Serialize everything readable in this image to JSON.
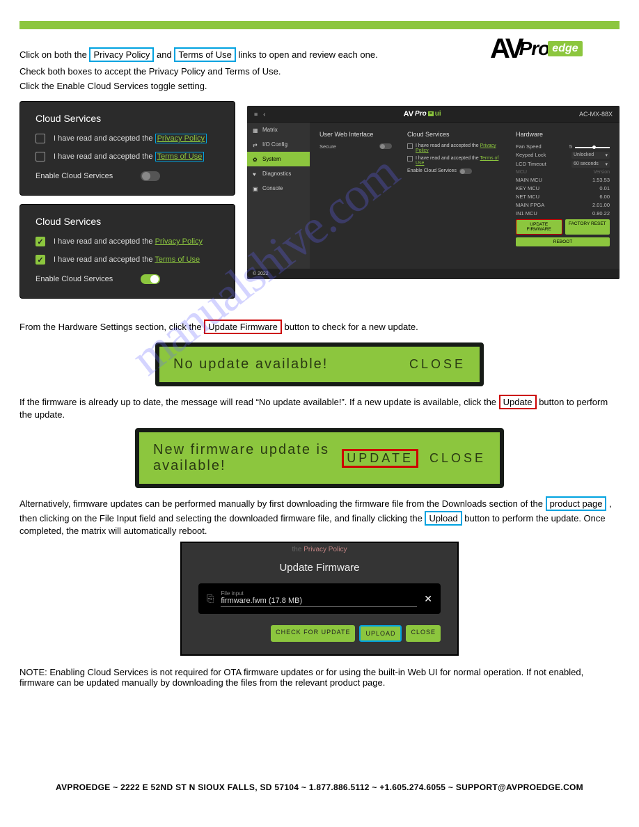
{
  "logo": {
    "a": "AV",
    "pro": "Pro",
    "edge": "edge"
  },
  "step3_pre": "Click on both the ",
  "step3_pp": "Privacy Policy",
  "step3_and": " and ",
  "step3_tu": "Terms of Use",
  "step3_post": " links to open and review each one.",
  "step4": "Check both boxes to accept the Privacy Policy and Terms of Use.",
  "step5": "Click the Enable Cloud Services toggle setting.",
  "cs": {
    "title": "Cloud Services",
    "row_pp_pre": "I have read and accepted the",
    "row_pp_link": "Privacy Policy",
    "row_tu_pre": "I have read and accepted the",
    "row_tu_link": "Terms of Use",
    "enable": "Enable Cloud Services"
  },
  "sys": {
    "model": "AC-MX-88X",
    "nav": [
      "Matrix",
      "I/O Config",
      "System",
      "Diagnostics",
      "Console"
    ],
    "col1_title": "User Web Interface",
    "secure": "Secure",
    "col2_title": "Cloud Services",
    "col3_title": "Hardware",
    "fan": "Fan Speed",
    "fan_val": "5",
    "kp": "Keypad Lock",
    "kp_val": "Unlocked",
    "lcd": "LCD Timeout",
    "lcd_val": "60 seconds",
    "mcu": "MCU",
    "ver": "Version",
    "rows": [
      [
        "MAIN MCU",
        "1.53.53"
      ],
      [
        "KEY MCU",
        "0.01"
      ],
      [
        "NET MCU",
        "6.00"
      ],
      [
        "MAIN FPGA",
        "2.01.00"
      ],
      [
        "IN1 MCU",
        "0.80.22"
      ]
    ],
    "upd": "UPDATE FIRMWARE",
    "fr": "FACTORY RESET",
    "reboot": "REBOOT",
    "footer": "© 2022",
    "ui": "ui"
  },
  "step6_pre": "From the Hardware Settings section, click the ",
  "step6_btn": "Update Firmware",
  "step6_post": " button to check for a new update.",
  "no_update_msg": "No update available!",
  "close": "CLOSE",
  "step7_pre": "If the firmware is already up to date, the message will read “No update available!”. If a new update is available, click the ",
  "step7_btn": "Update",
  "step7_post": " button to perform the update.",
  "new_update_msg": "New firmware update is available!",
  "update": "UPDATE",
  "step8_pre": "Alternatively, firmware updates can be performed manually by first downloading the firmware file from the Downloads section of the ",
  "step8_link": "product page",
  "step8_after": ", then clicking on the File Input field and selecting the downloaded firmware file, and finally clicking the ",
  "step8_upload": "Upload",
  "step8_end": " button to perform the update. Once completed, the matrix will automatically reboot.",
  "ufw": {
    "topstrip_the": "the",
    "topstrip_pp": "Privacy Policy",
    "title": "Update Firmware",
    "file_lbl": "File input",
    "file_val": "firmware.fwm (17.8 MB)",
    "check": "CHECK FOR UPDATE",
    "upload": "UPLOAD",
    "close": "CLOSE"
  },
  "note": "NOTE: Enabling Cloud Services is not required for OTA firmware updates or for using the built-in Web UI for normal operation. If not enabled, firmware can be updated manually by downloading the files from the relevant product page.",
  "watermark": "manualshive.com",
  "footer": "AVPROEDGE  ~  2222 E 52ND ST N SIOUX FALLS, SD 57104  ~  1.877.886.5112  ~  +1.605.274.6055  ~  SUPPORT@AVPROEDGE.COM"
}
